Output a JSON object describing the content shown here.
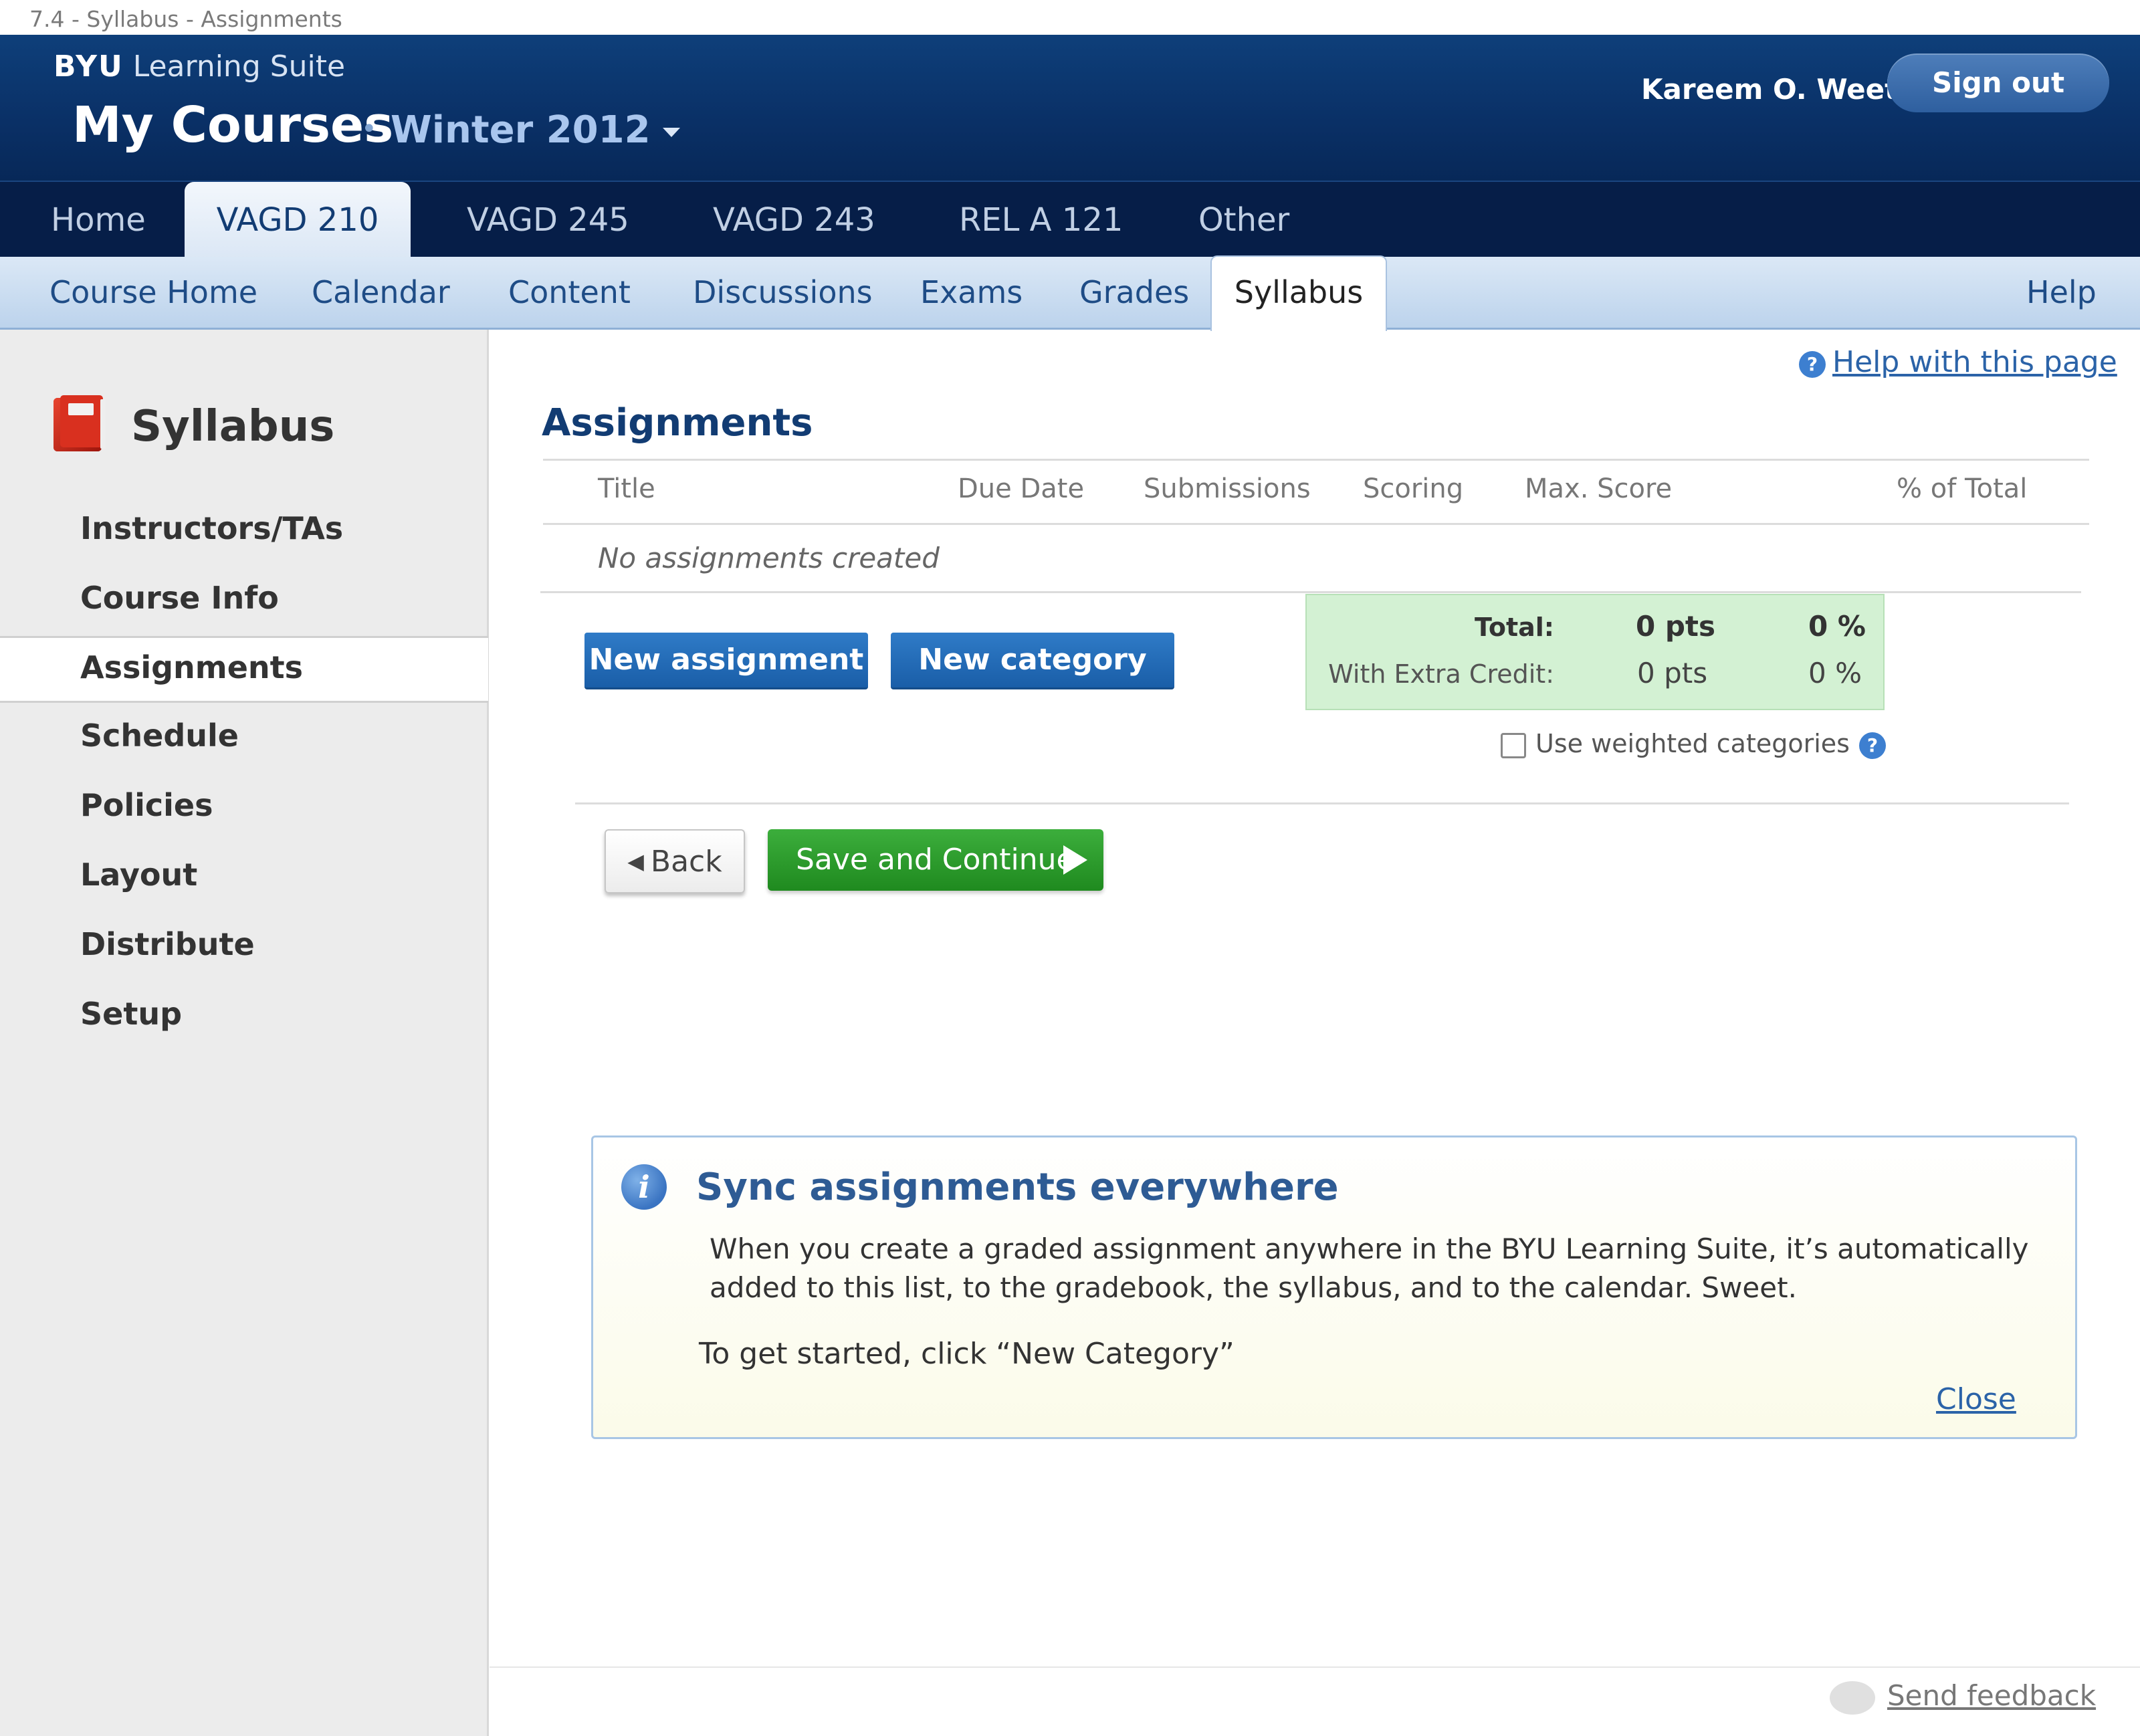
{
  "page_caption": "7.4 - Syllabus - Assignments",
  "header": {
    "brand_bold": "BYU",
    "brand_light": "Learning Suite",
    "title": "My Courses",
    "term": "Winter 2012",
    "user": "Kareem O. Weet",
    "sign_out": "Sign out"
  },
  "course_tabs": [
    "Home",
    "VAGD 210",
    "VAGD 245",
    "VAGD 243",
    "REL A 121",
    "Other"
  ],
  "sub_nav": [
    "Course Home",
    "Calendar",
    "Content",
    "Discussions",
    "Exams",
    "Grades",
    "Syllabus"
  ],
  "help_nav": "Help",
  "sidebar": {
    "title": "Syllabus",
    "items": [
      "Instructors/TAs",
      "Course Info",
      "Assignments",
      "Schedule",
      "Policies",
      "Layout",
      "Distribute",
      "Setup"
    ]
  },
  "main": {
    "help_link": "Help with this page",
    "section_title": "Assignments",
    "table_headers": [
      "Title",
      "Due Date",
      "Submissions",
      "Scoring",
      "Max. Score",
      "% of Total"
    ],
    "empty_text": "No assignments created",
    "new_assignment": "New assignment",
    "new_category": "New category",
    "totals": {
      "total_label": "Total:",
      "total_pts": "0 pts",
      "total_pct": "0 %",
      "extra_label": "With Extra Credit:",
      "extra_pts": "0 pts",
      "extra_pct": "0 %"
    },
    "weighted_label": "Use weighted categories",
    "back": "Back",
    "save_continue": "Save and Continue"
  },
  "info": {
    "title": "Sync assignments everywhere",
    "body": "When you create a graded assignment anywhere in the BYU Learning Suite, it’s automatically added to this list, to the gradebook, the syllabus, and to the calendar. Sweet.",
    "cta": "To get started, click “New Category”",
    "close": "Close"
  },
  "footer": {
    "feedback": "Send feedback"
  },
  "colors": {
    "header_navy": "#0a3066",
    "accent_blue": "#1a5ea8",
    "green": "#1f8a1f",
    "totals_bg": "#d3f1d3"
  }
}
